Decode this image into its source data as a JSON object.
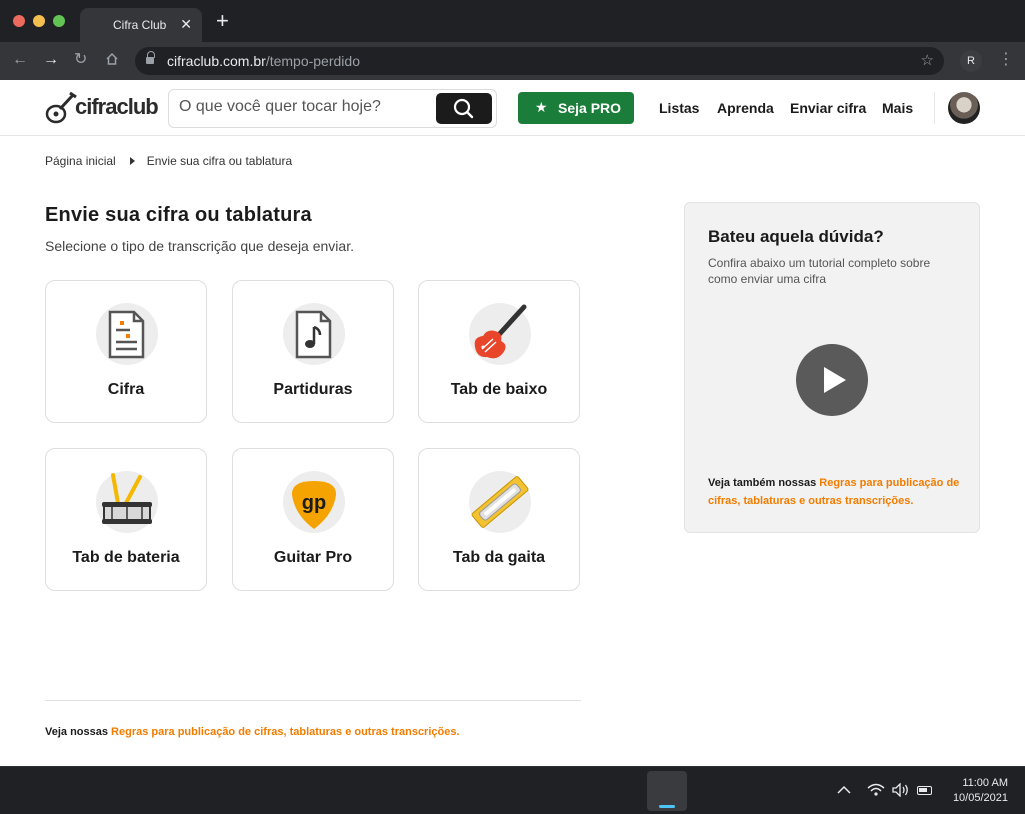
{
  "browser": {
    "tab_title": "Cifra Club",
    "tab_close": "✕",
    "new_tab": "+",
    "url_host": "cifraclub.com.br",
    "url_path": "/tempo-perdido",
    "profile_initial": "R"
  },
  "header": {
    "logo_text": "cifraclub",
    "search_placeholder": "O que você quer tocar hoje?",
    "pro_label": "Seja PRO",
    "nav": [
      "Listas",
      "Aprenda",
      "Enviar cifra",
      "Mais"
    ]
  },
  "breadcrumb": [
    "Página inicial",
    "Envie sua cifra ou tablatura"
  ],
  "main": {
    "title": "Envie sua cifra ou tablatura",
    "subtitle": "Selecione o tipo de transcrição que deseja enviar.",
    "cards": [
      {
        "label": "Cifra",
        "icon": "document-icon"
      },
      {
        "label": "Partiduras",
        "icon": "music-note-icon"
      },
      {
        "label": "Tab de baixo",
        "icon": "bass-guitar-icon"
      },
      {
        "label": "Tab de bateria",
        "icon": "drum-icon"
      },
      {
        "label": "Guitar Pro",
        "icon": "guitar-pro-icon",
        "icon_text": "gp"
      },
      {
        "label": "Tab da gaita",
        "icon": "harmonica-icon"
      }
    ]
  },
  "sidebar": {
    "title": "Bateu aquela dúvida?",
    "desc": "Confira abaixo um tutorial completo sobre como enviar uma cifra",
    "foot_prefix": "Veja também nossas ",
    "foot_link": "Regras para publicação de cifras, tablaturas e outras transcrições."
  },
  "footer": {
    "prefix": "Veja nossas ",
    "link": "Regras para publicação de cifras, tablaturas e outras transcrições."
  },
  "taskbar": {
    "time": "11:00 AM",
    "date": "10/05/2021"
  },
  "colors": {
    "accent_orange": "#f27c00",
    "pro_green": "#1b7d3a"
  }
}
